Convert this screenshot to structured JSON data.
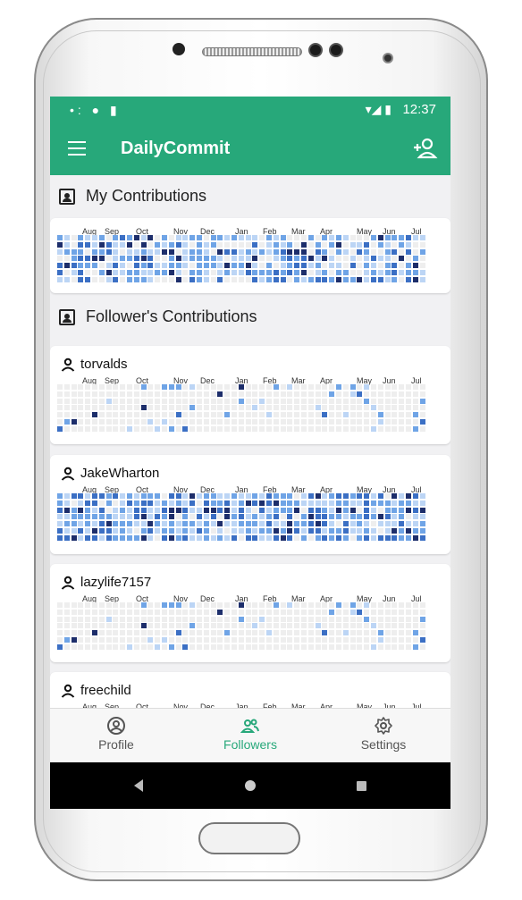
{
  "status": {
    "time": "12:37",
    "left_icons": "•: ● ▮",
    "right_icons": "▾◢ ▮"
  },
  "app": {
    "title": "DailyCommit"
  },
  "sections": {
    "mine": "My Contributions",
    "followers": "Follower's Contributions"
  },
  "months": [
    "Aug",
    "Sep",
    "Oct",
    "Nov",
    "Dec",
    "Jan",
    "Feb",
    "Mar",
    "Apr",
    "May",
    "Jun",
    "Jul"
  ],
  "users": [
    {
      "name": "torvalds"
    },
    {
      "name": "JakeWharton"
    },
    {
      "name": "lazylife7157"
    },
    {
      "name": "freechild"
    }
  ],
  "nav": {
    "profile": "Profile",
    "followers": "Followers",
    "settings": "Settings"
  },
  "colors": {
    "accent": "#27a87a",
    "empty": "#eeeeee",
    "l1": "#bcd5f5",
    "l2": "#6fa4e6",
    "l3": "#3b6fc4",
    "l4": "#1d2e6b"
  }
}
